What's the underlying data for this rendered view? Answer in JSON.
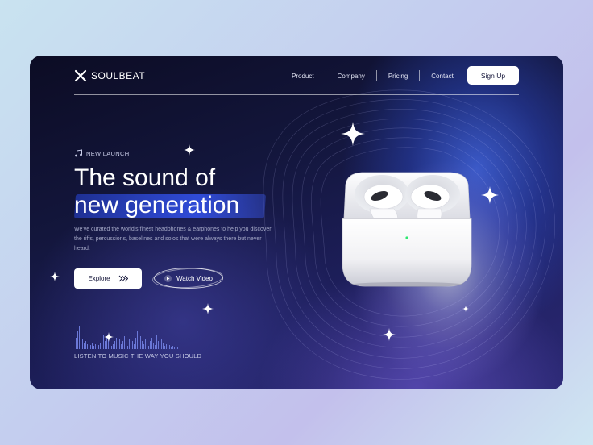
{
  "brand": {
    "name": "SOULBEAT",
    "icon": "x-logo-icon"
  },
  "nav": {
    "links": [
      "Product",
      "Company",
      "Pricing",
      "Contact"
    ],
    "signup_label": "Sign Up"
  },
  "hero": {
    "badge_icon": "music-note-icon",
    "badge": "NEW LAUNCH",
    "title_line1": "The sound of",
    "title_line2": "new generation",
    "description": "We've curated the world's finest headphones & earphones to help you discover the riffs, percussions, baselines and solos that were always there but never heard.",
    "explore_label": "Explore",
    "explore_icon": "double-chevron-right-icon",
    "watch_label": "Watch Video",
    "watch_icon": "play-icon",
    "tagline": "LISTEN TO MUSIC THE WAY YOU SHOULD"
  },
  "product": {
    "image": "airpods-case",
    "status_light": "#2ee870"
  },
  "colors": {
    "accent": "#2f53e6",
    "background_dark": "#0c0c24",
    "button_bg": "#ffffff",
    "button_text": "#15163a"
  }
}
